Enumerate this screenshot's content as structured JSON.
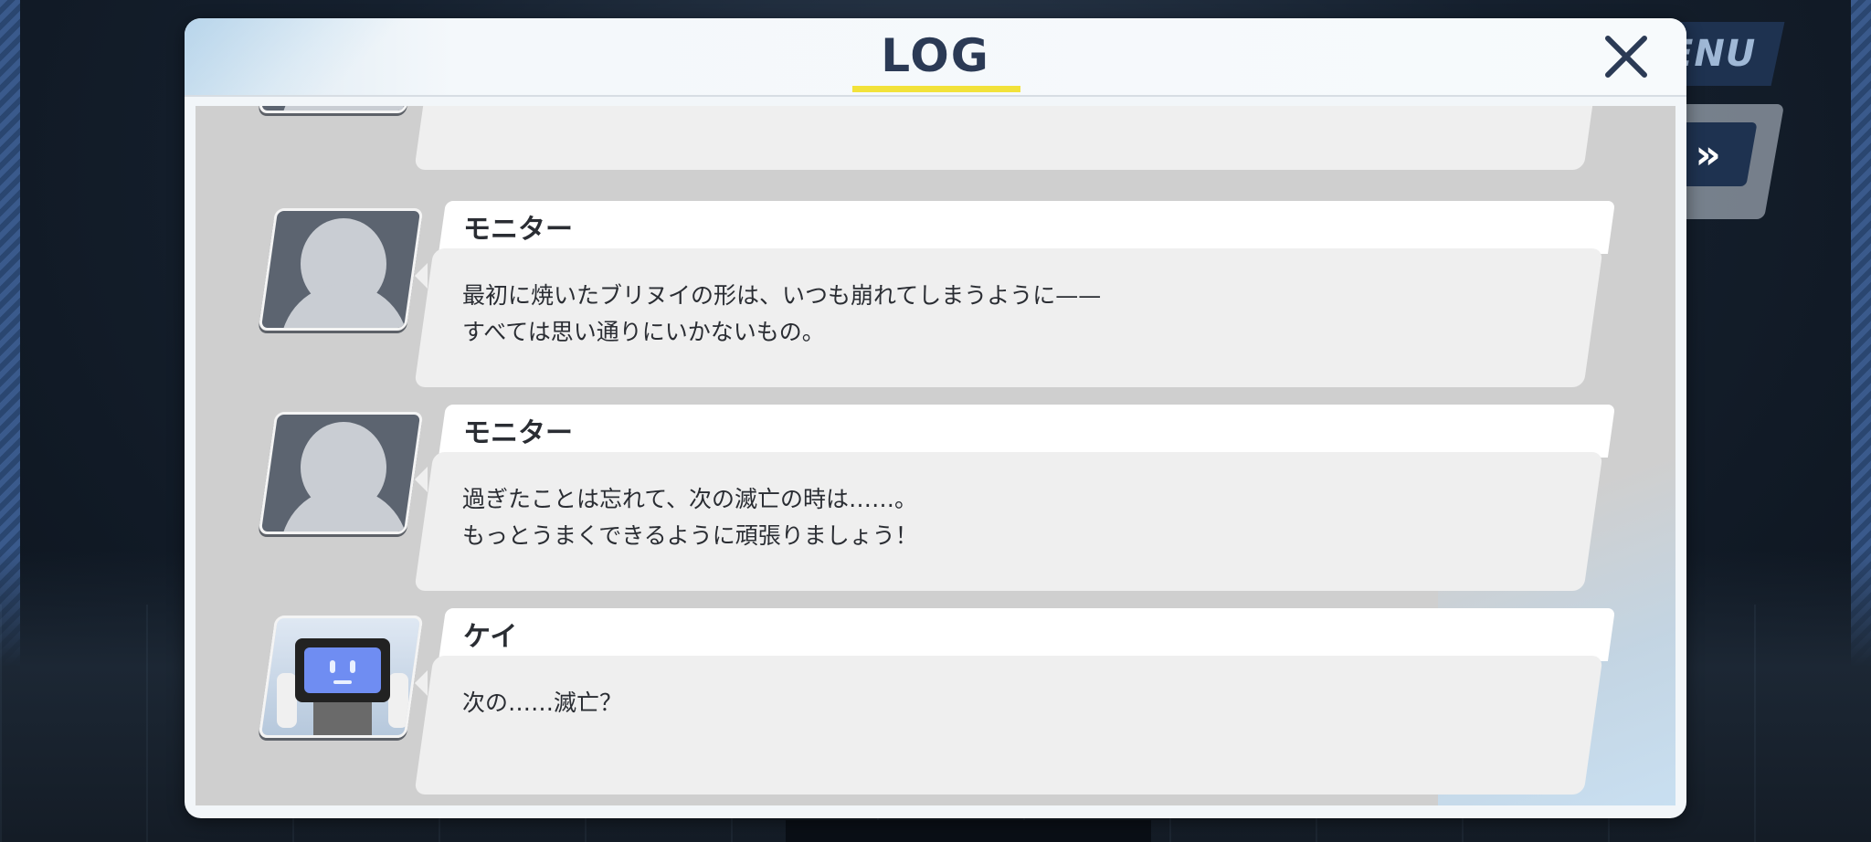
{
  "header": {
    "title": "LOG"
  },
  "background_ui": {
    "menu_label": "ENU",
    "skip_label": "»"
  },
  "log_entries": [
    {
      "speaker": "",
      "lines": [],
      "avatar": "silhouette"
    },
    {
      "speaker": "モニター",
      "lines": [
        "最初に焼いたブリヌイの形は、いつも崩れてしまうように——",
        "すべては思い通りにいかないもの。"
      ],
      "avatar": "silhouette"
    },
    {
      "speaker": "モニター",
      "lines": [
        "過ぎたことは忘れて、次の滅亡の時は……。",
        "もっとうまくできるように頑張りましょう！"
      ],
      "avatar": "silhouette"
    },
    {
      "speaker": "ケイ",
      "lines": [
        "次の……滅亡？"
      ],
      "avatar": "robot"
    }
  ],
  "colors": {
    "title": "#2b3a55",
    "underline": "#f2e23a",
    "panel_bg": "#f2f6f9",
    "log_bg": "#cfcfcf"
  }
}
